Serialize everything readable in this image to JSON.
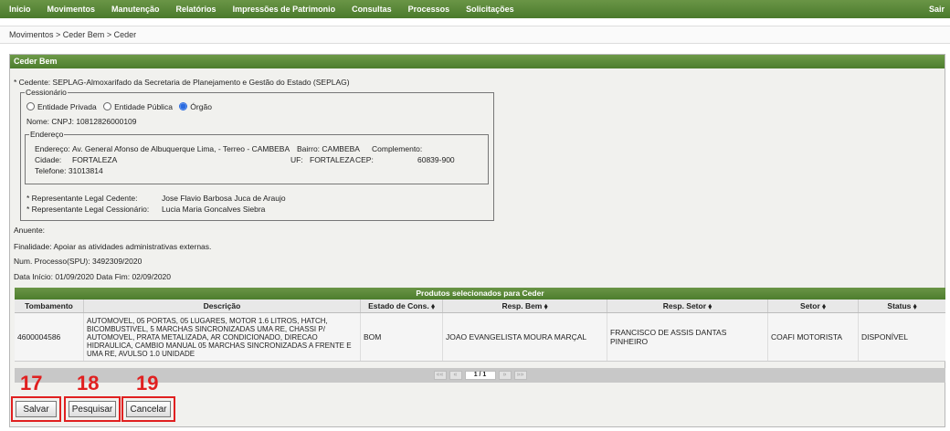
{
  "menu": [
    "Inicio",
    "Movimentos",
    "Manutenção",
    "Relatórios",
    "Impressões de Patrimonio",
    "Consultas",
    "Processos",
    "Solicitações"
  ],
  "menu_exit": "Sair",
  "breadcrumb": [
    "Movimentos",
    "Ceder Bem",
    "Ceder"
  ],
  "breadcrumb_sep": " > ",
  "panel_title": "Ceder Bem",
  "cedente": "* Cedente: SEPLAG-Almoxarifado da Secretaria de Planejamento e Gestão do Estado (SEPLAG)",
  "cessionario": {
    "legend": "Cessionário",
    "radios": [
      {
        "label": "Entidade Privada",
        "checked": false
      },
      {
        "label": "Entidade Pública",
        "checked": false
      },
      {
        "label": "Órgão",
        "checked": true
      }
    ],
    "nome": "Nome:  CNPJ:  10812826000109"
  },
  "endereco": {
    "legend": "Endereço",
    "endereco_label": "Endereço:",
    "endereco_value": "Av. General Afonso de Albuquerque Lima, - Terreo - CAMBEBA",
    "bairro": "Bairro:  CAMBEBA",
    "complemento": "Complemento:",
    "cidade_label": "Cidade:",
    "cidade_value": "FORTALEZA",
    "uf_label": "UF:",
    "uf_value": "FORTALEZA",
    "cep_label": "CEP:",
    "cep_value": "60839-900",
    "telefone": "Telefone:  31013814"
  },
  "rep_cedente_label": "* Representante Legal Cedente:",
  "rep_cedente_value": "Jose Flavio Barbosa Juca de Araujo",
  "rep_cessionario_label": "* Representante Legal Cessionário:",
  "rep_cessionario_value": "Lucia Maria Goncalves Siebra",
  "anuente": "Anuente:",
  "finalidade": "Finalidade:  Apoiar as atividades administrativas externas.",
  "processo": "Num. Processo(SPU):  3492309/2020",
  "datas": "Data Início:  01/09/2020   Data Fim:  02/09/2020",
  "table": {
    "title": "Produtos selecionados para Ceder",
    "headers": [
      "Tombamento",
      "Descrição",
      "Estado de Cons. ⬧",
      "Resp. Bem ⬧",
      "Resp. Setor ⬧",
      "Setor ⬧",
      "Status ⬧"
    ],
    "rows": [
      [
        "4600004586",
        "AUTOMOVEL, 05 PORTAS, 05 LUGARES, MOTOR 1.6 LITROS, HATCH, BICOMBUSTIVEL, 5 MARCHAS SINCRONIZADAS UMA RE, CHASSI P/ AUTOMOVEL, PRATA METALIZADA, AR CONDICIONADO, DIRECAO HIDRAULICA, CAMBIO MANUAL 05 MARCHAS SINCRONIZADAS A FRENTE E UMA RE, AVULSO 1.0 UNIDADE",
        "BOM",
        "JOAO EVANGELISTA MOURA MARÇAL",
        "FRANCISCO DE ASSIS DANTAS PINHEIRO",
        "COAFI MOTORISTA",
        "DISPONÍVEL"
      ]
    ],
    "pager": [
      "«« ",
      " « ",
      "1 / 1",
      " » ",
      " »»"
    ]
  },
  "buttons": [
    {
      "label": "Salvar",
      "annotation": "17"
    },
    {
      "label": "Pesquisar",
      "annotation": "18"
    },
    {
      "label": "Cancelar",
      "annotation": "19"
    }
  ],
  "colors": {
    "menu_green": "#5a8a3a",
    "annotation_red": "#e02020",
    "radio_blue": "#2a6be0"
  }
}
